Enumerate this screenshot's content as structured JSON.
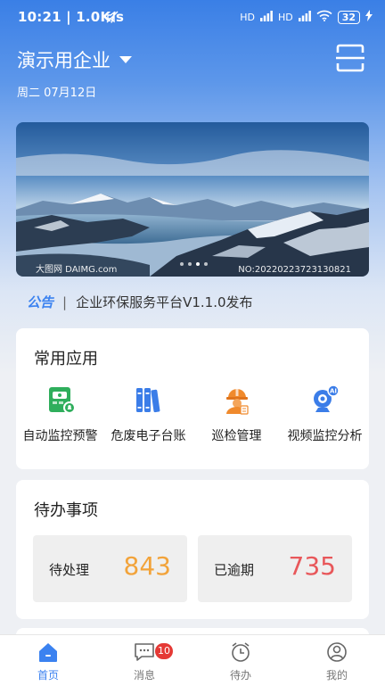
{
  "status_bar": {
    "time": "10:21 | 1.0K/s",
    "battery": "32",
    "signal1": "HD",
    "signal2": "HD"
  },
  "header": {
    "company": "演示用企业",
    "date": "周二 07月12日"
  },
  "banner": {
    "watermark_left": "大图网 DAIMG.com",
    "watermark_right": "NO:20220223723130821",
    "slide_count": 4,
    "active_slide": 2
  },
  "notice": {
    "tag": "公告",
    "text": "企业环保服务平台V1.1.0发布"
  },
  "common_apps": {
    "title": "常用应用",
    "items": [
      {
        "label": "自动监控预警",
        "icon": "monitor-alarm-icon"
      },
      {
        "label": "危废电子台账",
        "icon": "ledger-books-icon"
      },
      {
        "label": "巡检管理",
        "icon": "inspector-helmet-icon"
      },
      {
        "label": "视频监控分析",
        "icon": "ai-camera-icon"
      }
    ]
  },
  "todo": {
    "title": "待办事项",
    "pending_label": "待处理",
    "pending_value": "843",
    "overdue_label": "已逾期",
    "overdue_value": "735"
  },
  "tabbar": {
    "items": [
      {
        "label": "首页",
        "icon": "home-icon",
        "active": true
      },
      {
        "label": "消息",
        "icon": "message-icon",
        "badge": "10"
      },
      {
        "label": "待办",
        "icon": "clock-icon"
      },
      {
        "label": "我的",
        "icon": "user-icon"
      }
    ]
  },
  "colors": {
    "accent": "#3b82f0",
    "pending": "#f2a33a",
    "overdue": "#e8575a",
    "badge": "#e53935"
  }
}
